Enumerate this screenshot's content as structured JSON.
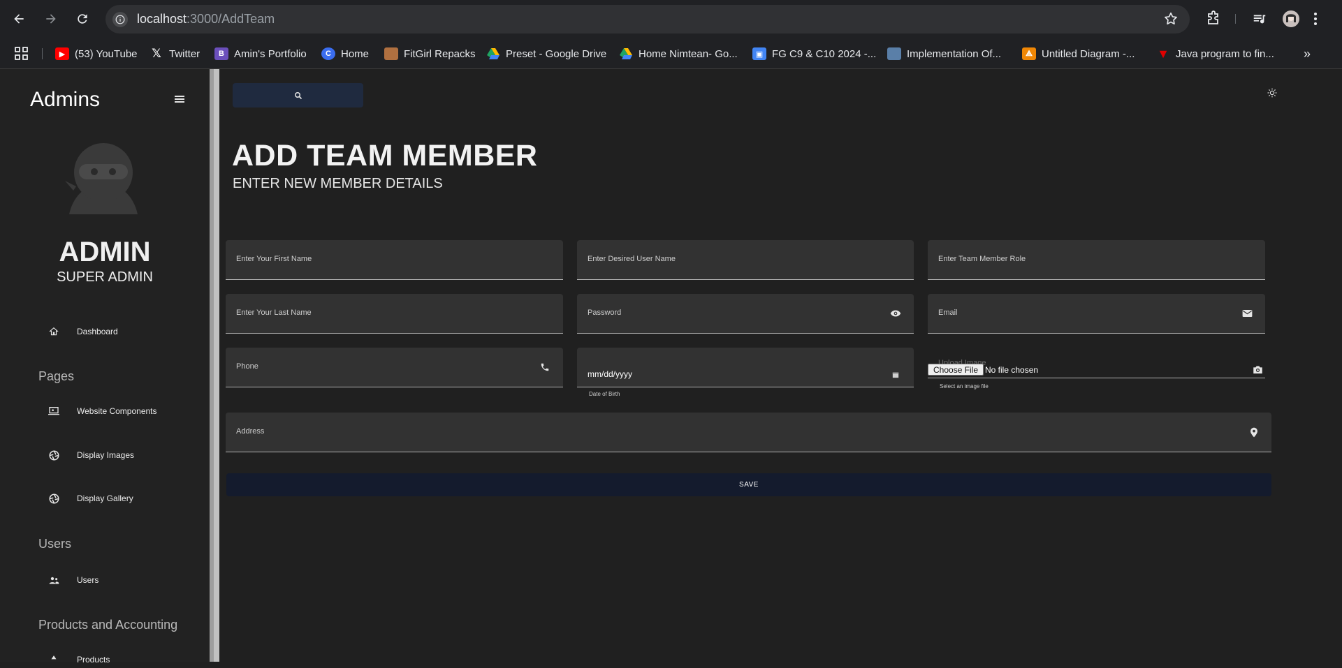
{
  "browser": {
    "url_host": "localhost",
    "url_path": ":3000/AddTeam",
    "bookmarks": [
      {
        "label": "(53) YouTube",
        "icon": "youtube-icon",
        "color": "#ff0000"
      },
      {
        "label": "Twitter",
        "icon": "x-icon",
        "color": "#ffffff"
      },
      {
        "label": "Amin's Portfolio",
        "icon": "b-icon",
        "color": "#6b4fbb"
      },
      {
        "label": "Home",
        "icon": "c-icon",
        "color": "#3a6df0"
      },
      {
        "label": "FitGirl Repacks",
        "icon": "fitgirl-icon",
        "color": "#b07040"
      },
      {
        "label": "Preset - Google Drive",
        "icon": "google-drive-icon",
        "color": "#1fa463"
      },
      {
        "label": "Home Nimtean- Go...",
        "icon": "google-drive-icon",
        "color": "#1fa463"
      },
      {
        "label": "FG C9 & C10 2024 -...",
        "icon": "classroom-icon",
        "color": "#4285f4"
      },
      {
        "label": "Implementation Of...",
        "icon": "implementation-icon",
        "color": "#5a7fa8"
      },
      {
        "label": "Untitled Diagram -...",
        "icon": "drawio-icon",
        "color": "#f08705"
      },
      {
        "label": "Java program to fin...",
        "icon": "v-icon",
        "color": "#e00000"
      }
    ]
  },
  "sidebar": {
    "title": "Admins",
    "user_name": "ADMIN",
    "user_role": "SUPER ADMIN",
    "items": {
      "dashboard": "Dashboard",
      "pages_section": "Pages",
      "website_components": "Website Components",
      "display_images": "Display Images",
      "display_gallery": "Display Gallery",
      "users_section": "Users",
      "users": "Users",
      "products_section": "Products and Accounting",
      "products": "Products"
    }
  },
  "main": {
    "title": "ADD TEAM MEMBER",
    "subtitle": "ENTER NEW MEMBER DETAILS",
    "fields": {
      "first_name": "Enter Your First Name",
      "user_name": "Enter Desired User Name",
      "role": "Enter Team Member Role",
      "last_name": "Enter Your Last Name",
      "password": "Password",
      "email": "Email",
      "phone": "Phone",
      "dob_value": "mm/dd/yyyy",
      "dob_helper": "Date of Birth",
      "upload_label": "Upload Image",
      "choose_file": "Choose File",
      "no_file": "No file chosen",
      "upload_helper": "Select an image file",
      "address": "Address"
    },
    "save_label": "SAVE"
  },
  "colors": {
    "sidebar_bg": "#222222",
    "main_bg": "#202020",
    "field_bg": "#323232",
    "save_bg": "#141b2d",
    "search_bg": "#1f2a3f"
  }
}
